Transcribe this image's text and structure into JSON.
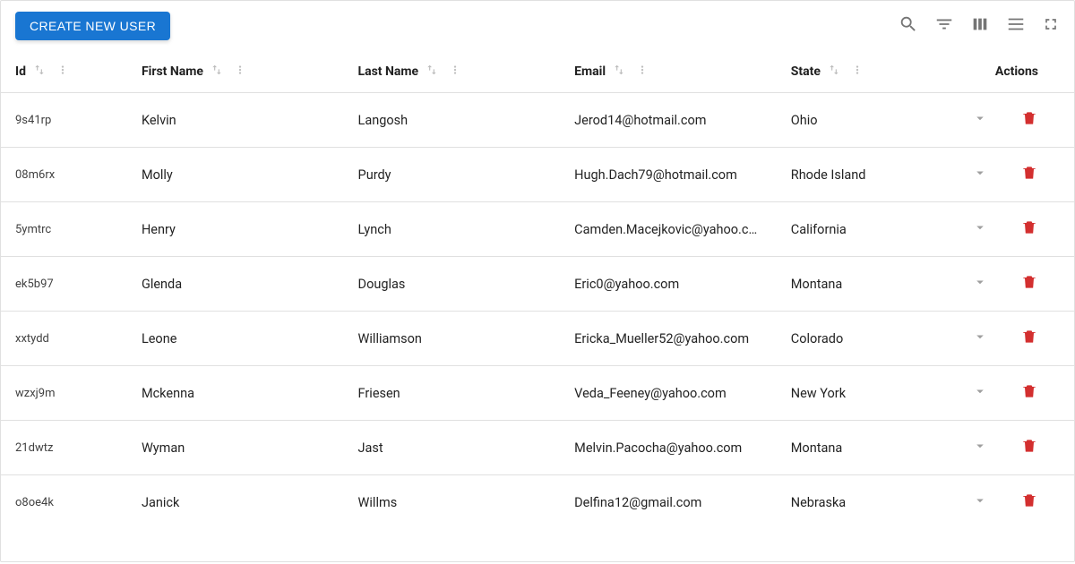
{
  "toolbar": {
    "create_label": "CREATE NEW USER"
  },
  "columns": {
    "id": "Id",
    "first_name": "First Name",
    "last_name": "Last Name",
    "email": "Email",
    "state": "State",
    "actions": "Actions"
  },
  "rows": [
    {
      "id": "9s41rp",
      "first_name": "Kelvin",
      "last_name": "Langosh",
      "email": "Jerod14@hotmail.com",
      "state": "Ohio"
    },
    {
      "id": "08m6rx",
      "first_name": "Molly",
      "last_name": "Purdy",
      "email": "Hugh.Dach79@hotmail.com",
      "state": "Rhode Island"
    },
    {
      "id": "5ymtrc",
      "first_name": "Henry",
      "last_name": "Lynch",
      "email": "Camden.Macejkovic@yahoo.com",
      "state": "California"
    },
    {
      "id": "ek5b97",
      "first_name": "Glenda",
      "last_name": "Douglas",
      "email": "Eric0@yahoo.com",
      "state": "Montana"
    },
    {
      "id": "xxtydd",
      "first_name": "Leone",
      "last_name": "Williamson",
      "email": "Ericka_Mueller52@yahoo.com",
      "state": "Colorado"
    },
    {
      "id": "wzxj9m",
      "first_name": "Mckenna",
      "last_name": "Friesen",
      "email": "Veda_Feeney@yahoo.com",
      "state": "New York"
    },
    {
      "id": "21dwtz",
      "first_name": "Wyman",
      "last_name": "Jast",
      "email": "Melvin.Pacocha@yahoo.com",
      "state": "Montana"
    },
    {
      "id": "o8oe4k",
      "first_name": "Janick",
      "last_name": "Willms",
      "email": "Delfina12@gmail.com",
      "state": "Nebraska"
    }
  ]
}
